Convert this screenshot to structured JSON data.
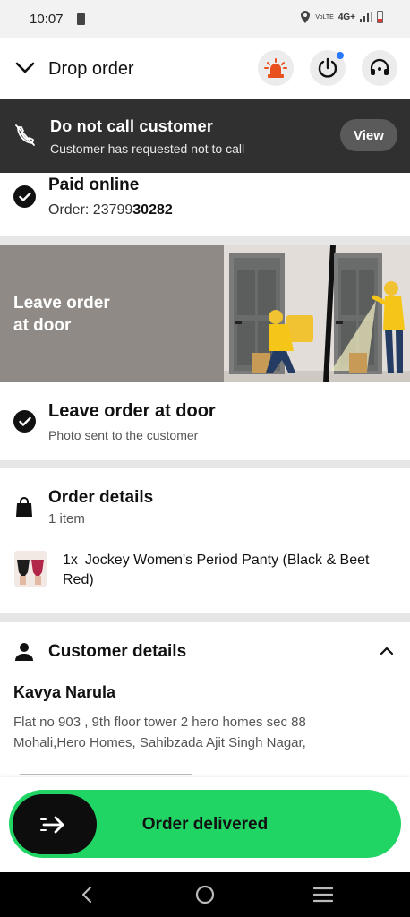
{
  "status_bar": {
    "time": "10:07",
    "network": "4G+"
  },
  "header": {
    "title": "Drop order",
    "icons": [
      "chevron-down-icon",
      "alarm-icon",
      "power-icon",
      "support-icon"
    ]
  },
  "banner": {
    "title": "Do not call customer",
    "subtitle": "Customer has requested not to call",
    "button_label": "View"
  },
  "payment": {
    "title": "Paid online",
    "order_prefix": "Order: 23799",
    "order_suffix": "30282"
  },
  "illustration": {
    "line1": "Leave order",
    "line2": "at door"
  },
  "delivery_instruction": {
    "title": "Leave order at door",
    "subtitle": "Photo sent to the customer"
  },
  "order_details": {
    "title": "Order details",
    "count": "1 item",
    "items": [
      {
        "qty": "1x",
        "name": "Jockey Women's Period Panty (Black & Beet Red)"
      }
    ]
  },
  "customer_details": {
    "title": "Customer details",
    "name": "Kavya Narula",
    "address_line1": "Flat no 903 , 9th floor tower 2 hero homes sec 88",
    "address_line2": "Mohali,Hero Homes, Sahibzada Ajit Singh Nagar,"
  },
  "action": {
    "label": "Order delivered"
  },
  "colors": {
    "accent_green": "#21d565",
    "banner_bg": "#303030",
    "notification_dot": "#2979ff"
  }
}
